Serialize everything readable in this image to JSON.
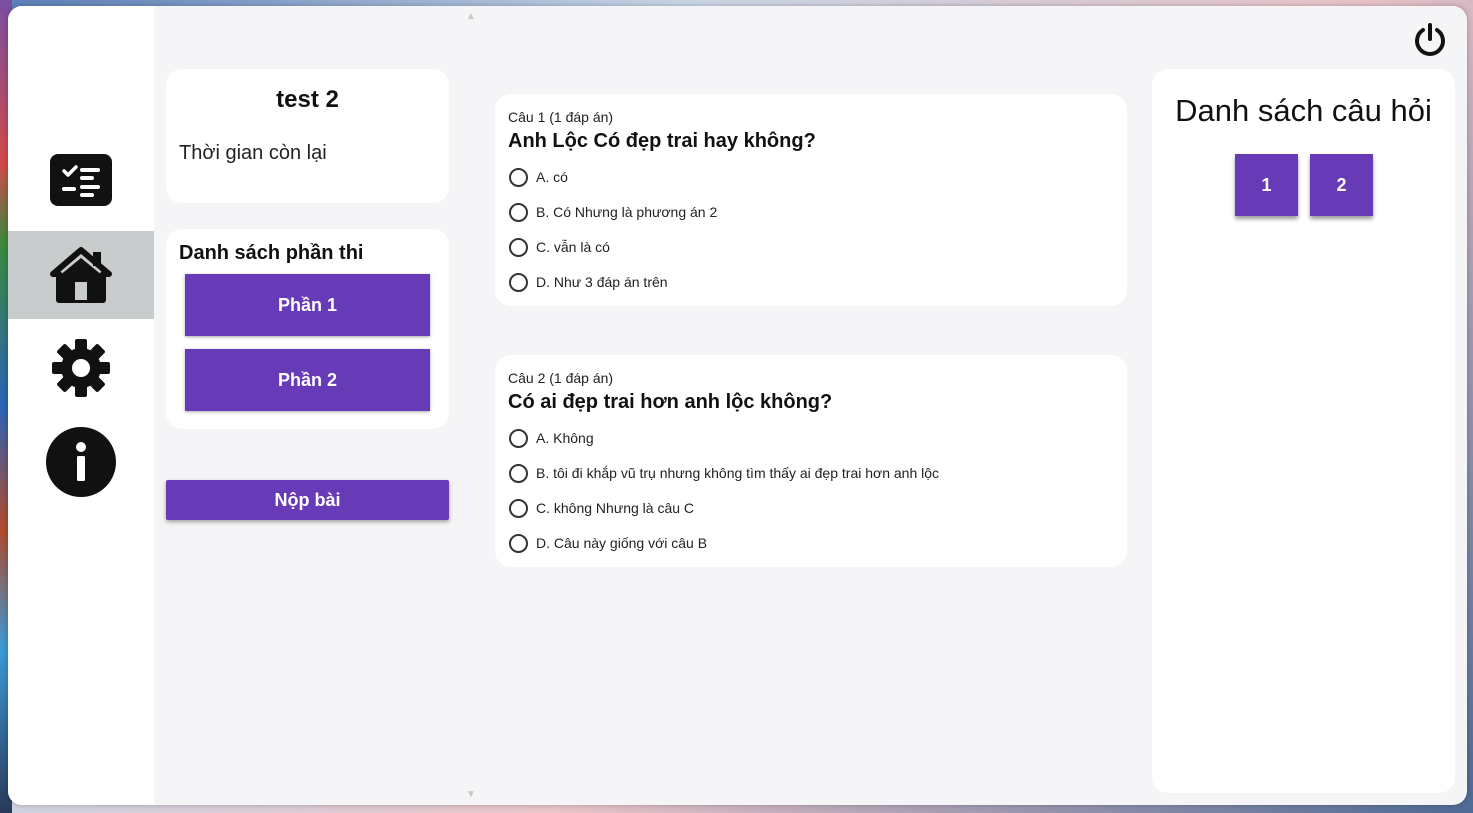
{
  "sidebar": {
    "items": [
      {
        "icon": "checklist-icon",
        "active": false
      },
      {
        "icon": "home-icon",
        "active": true
      },
      {
        "icon": "gear-icon",
        "active": false
      },
      {
        "icon": "info-icon",
        "active": false
      }
    ]
  },
  "header": {
    "power_icon": "power-icon"
  },
  "test": {
    "title": "test 2",
    "time_label": "Thời gian còn lại"
  },
  "parts": {
    "title": "Danh sách phần thi",
    "items": [
      {
        "label": "Phần 1"
      },
      {
        "label": "Phần 2"
      }
    ]
  },
  "submit": {
    "label": "Nộp bài"
  },
  "questions": [
    {
      "meta": "Câu 1 (1 đáp án)",
      "text": "Anh Lộc Có đẹp trai hay không?",
      "options": [
        "A. có",
        "B. Có Nhưng là phương án 2",
        "C. vẫn là có",
        "D. Như 3 đáp án trên"
      ]
    },
    {
      "meta": "Câu 2 (1 đáp án)",
      "text": "Có ai đẹp trai hơn anh lộc không?",
      "options": [
        "A. Không",
        "B. tôi đi khắp vũ trụ nhưng không tìm thấy ai đẹp trai hơn anh lộc",
        "C. không Nhưng là câu C",
        "D. Câu này giống với câu B"
      ]
    }
  ],
  "question_list": {
    "title": "Danh sách câu hỏi",
    "numbers": [
      "1",
      "2"
    ]
  },
  "colors": {
    "accent": "#673ab7",
    "window_bg": "#f5f5f7",
    "card_bg": "#ffffff",
    "sidebar_active": "#c9cccc"
  }
}
